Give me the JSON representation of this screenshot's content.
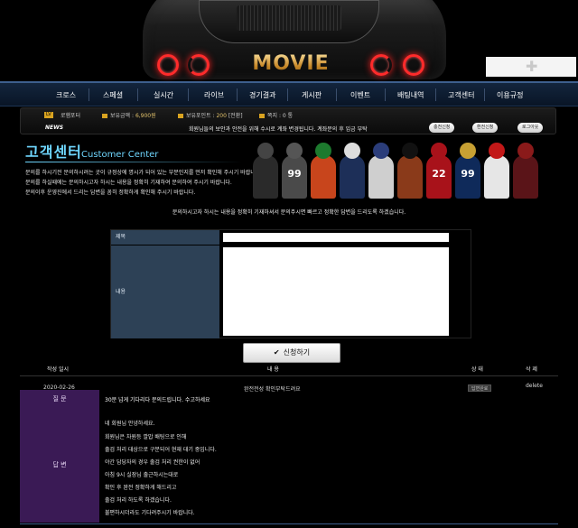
{
  "header": {
    "logo_text": "MOVIE"
  },
  "nav": {
    "items": [
      "크로스",
      "스페셜",
      "실시간",
      "라이브",
      "경기결과",
      "게시판",
      "이벤트",
      "배팅내역",
      "고객센터",
      "이용규정"
    ]
  },
  "infobar": {
    "level_badge": "LV",
    "nickname": "로햄포터",
    "balance_label": "보유금액 :",
    "balance_value": "6,900원",
    "points_label": "보유포인트 :",
    "points_value": "200",
    "points_button": "[전환]",
    "messages_label": "쪽지 :",
    "messages_value": "0 통",
    "news_label": "NEWS",
    "news_text": "회원님들의 보안과 안전을 위해 수시로 계좌 변경됩니다. 계좌문의 후 입금 부탁",
    "btn_charge": "충전신청",
    "btn_exchange": "환전신청",
    "btn_logout": "로그아웃"
  },
  "banner": {
    "title": "고객센터",
    "subtitle": "Customer Center",
    "desc": [
      "문의를 하시기전 문의하시려는 곳이 규정상에 명시가 되어 있는 부분인지를 먼저 확인해 주시기 바랍니다.",
      "문의를 하실때에는 문의하시고자 하시는 내용을 정확히 기재하여 문의하여 주시기 바랍니다.",
      "문의이후 운영진에서 드리는 답변을 꼼히 정확하게 확인해 주시기 바랍니다."
    ],
    "player_numbers": [
      "",
      "99",
      "",
      "",
      "",
      "",
      "22",
      "99",
      "",
      ""
    ]
  },
  "notice": "문의하시고자 하시는 내용을 정확히 기재하셔서 문의주시면 빠르고 정확한 답변을 드리도록 하겠습니다.",
  "form": {
    "title_label": "제목",
    "content_label": "내용",
    "title_value": "",
    "content_value": "",
    "submit_label": "신청하기"
  },
  "table": {
    "headers": {
      "date": "작성 일시",
      "content": "내 용",
      "status": "상 태",
      "delete": "삭 제"
    },
    "row": {
      "date": "2020-02-26",
      "title": "완전전성 확인부탁드려요",
      "status": "답변완료",
      "delete": "delete"
    },
    "question_label": "질 문",
    "question_text": "30분 넘게 기다리다 문의드립니다. 수고하세요",
    "answer_label": "답 변",
    "answer_lines": [
      "네 회원님 안녕하세요.",
      "회원님은 차원등 깔밥 배팅으로 인해",
      "출검 처리 대상으로 구분되어 현재 대기 중입니다.",
      "야간 담당자의 경우 출검 처리 권한이 없어",
      "아침 9시 실장님 출근하시는대로",
      "확인 후 완전 정확하게 해드리고",
      "출검 처리 하도록 하겠습니다.",
      "불편하시더라도 기다려주시기 바랍니다."
    ]
  }
}
